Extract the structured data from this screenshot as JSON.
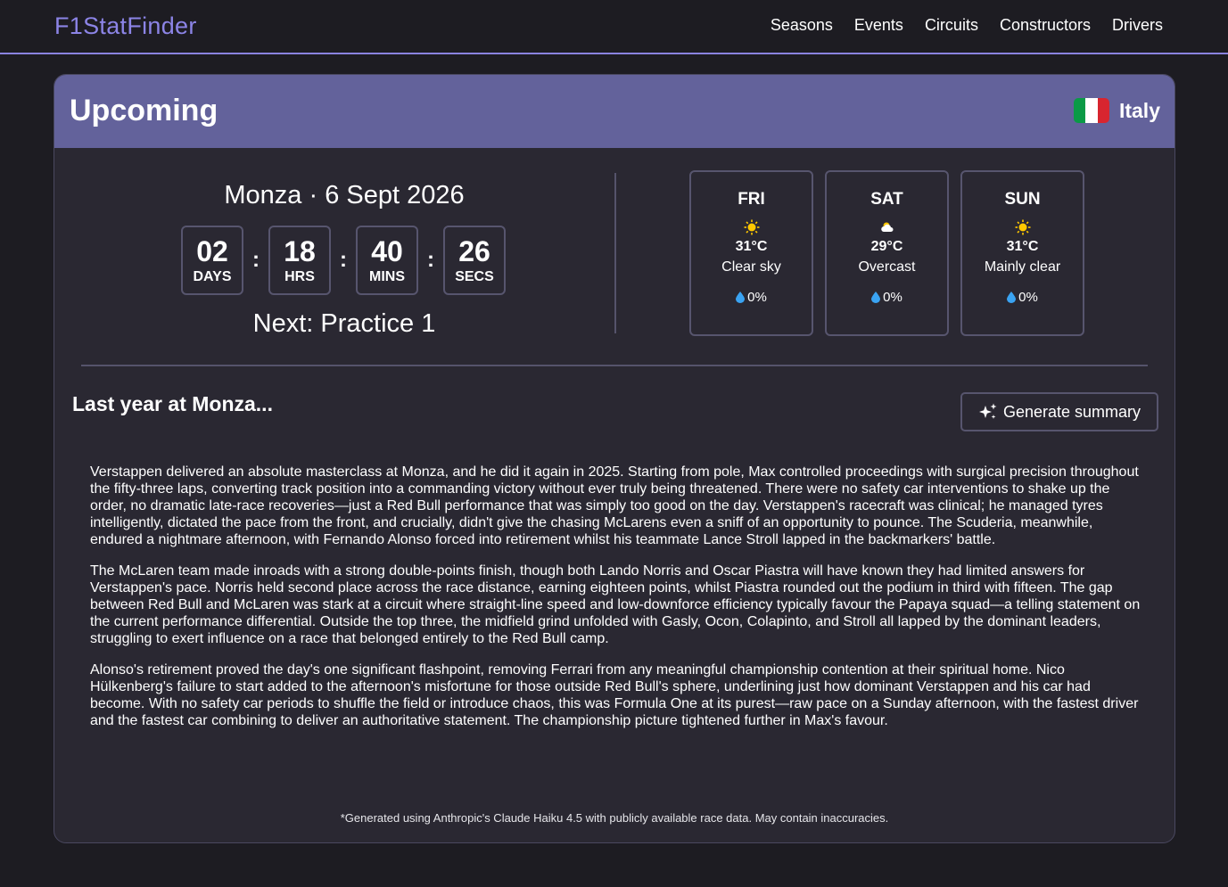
{
  "nav": {
    "brand": "F1StatFinder",
    "links": [
      "Seasons",
      "Events",
      "Circuits",
      "Constructors",
      "Drivers"
    ]
  },
  "card": {
    "title": "Upcoming",
    "country": "Italy",
    "flag_colors": [
      "#0a9a46",
      "#ffffff",
      "#d8252f"
    ]
  },
  "race": {
    "venue_date": "Monza · 6 Sept 2026",
    "countdown": [
      {
        "value": "02",
        "unit": "DAYS"
      },
      {
        "value": "18",
        "unit": "HRS"
      },
      {
        "value": "40",
        "unit": "MINS"
      },
      {
        "value": "26",
        "unit": "SECS"
      }
    ],
    "separator": ":",
    "next": "Next: Practice 1"
  },
  "weather": [
    {
      "day": "FRI",
      "icon": "sun-icon",
      "temp": "31°C",
      "condition": "Clear sky",
      "rain": "0%"
    },
    {
      "day": "SAT",
      "icon": "cloud-icon",
      "temp": "29°C",
      "condition": "Overcast",
      "rain": "0%"
    },
    {
      "day": "SUN",
      "icon": "sun-icon",
      "temp": "31°C",
      "condition": "Mainly clear",
      "rain": "0%"
    }
  ],
  "last_year": {
    "title": "Last year at Monza...",
    "button_label": "Generate summary",
    "paragraphs": [
      "Verstappen delivered an absolute masterclass at Monza, and he did it again in 2025. Starting from pole, Max controlled proceedings with surgical precision throughout the fifty-three laps, converting track position into a commanding victory without ever truly being threatened. There were no safety car interventions to shake up the order, no dramatic late-race recoveries—just a Red Bull performance that was simply too good on the day. Verstappen's racecraft was clinical; he managed tyres intelligently, dictated the pace from the front, and crucially, didn't give the chasing McLarens even a sniff of an opportunity to pounce. The Scuderia, meanwhile, endured a nightmare afternoon, with Fernando Alonso forced into retirement whilst his teammate Lance Stroll lapped in the backmarkers' battle.",
      "The McLaren team made inroads with a strong double-points finish, though both Lando Norris and Oscar Piastra will have known they had limited answers for Verstappen's pace. Norris held second place across the race distance, earning eighteen points, whilst Piastra rounded out the podium in third with fifteen. The gap between Red Bull and McLaren was stark at a circuit where straight-line speed and low-downforce efficiency typically favour the Papaya squad—a telling statement on the current performance differential. Outside the top three, the midfield grind unfolded with Gasly, Ocon, Colapinto, and Stroll all lapped by the dominant leaders, struggling to exert influence on a race that belonged entirely to the Red Bull camp.",
      "Alonso's retirement proved the day's one significant flashpoint, removing Ferrari from any meaningful championship contention at their spiritual home. Nico Hülkenberg's failure to start added to the afternoon's misfortune for those outside Red Bull's sphere, underlining just how dominant Verstappen and his car had become. With no safety car periods to shuffle the field or introduce chaos, this was Formula One at its purest—raw pace on a Sunday afternoon, with the fastest driver and the fastest car combining to deliver an authoritative statement. The championship picture tightened further in Max's favour."
    ],
    "disclaimer": "*Generated using Anthropic's Claude Haiku 4.5 with publicly available race data. May contain inaccuracies."
  }
}
